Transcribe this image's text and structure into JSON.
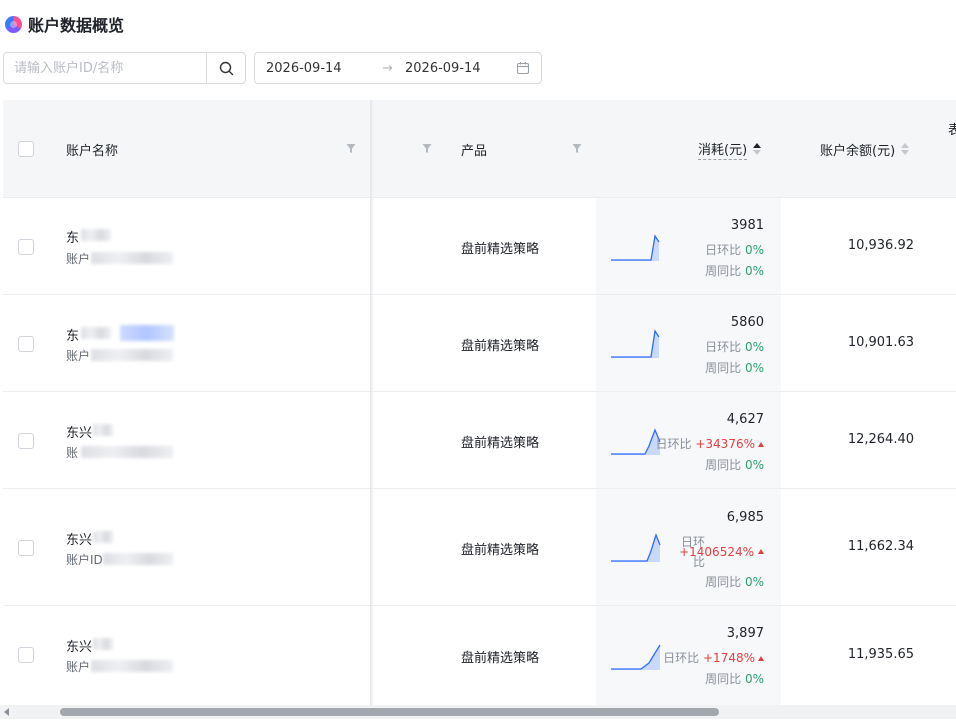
{
  "header": {
    "title": "账户数据概览"
  },
  "search": {
    "placeholder": "请输入账户ID/名称",
    "value": ""
  },
  "date_range": {
    "start": "2026-09-14",
    "separator": "→",
    "end": "2026-09-14"
  },
  "table": {
    "columns": {
      "name": "账户名称",
      "product": "产品",
      "cost": "消耗(元)",
      "balance": "账户余额(元)",
      "truncated": "表"
    },
    "rows": [
      {
        "name_prefix": "东",
        "sub_prefix": "账户",
        "product": "盘前精选策略",
        "cost": "3981",
        "day_label": "日环比",
        "day_pct": "0%",
        "day_trend": "flat",
        "week_label": "周同比",
        "week_pct": "0%",
        "balance": "10,936.92"
      },
      {
        "name_prefix": "东",
        "sub_prefix": "账户",
        "product": "盘前精选策略",
        "cost": "5860",
        "day_label": "日环比",
        "day_pct": "0%",
        "day_trend": "flat",
        "week_label": "周同比",
        "week_pct": "0%",
        "balance": "10,901.63"
      },
      {
        "name_prefix": "东兴",
        "sub_prefix": "账",
        "product": "盘前精选策略",
        "cost": "4,627",
        "day_label": "日环比",
        "day_pct": "+34376%",
        "day_trend": "up",
        "week_label": "周同比",
        "week_pct": "0%",
        "balance": "12,264.40"
      },
      {
        "name_prefix": "东兴",
        "sub_prefix": "账户ID",
        "product": "盘前精选策略",
        "cost": "6,985",
        "day_label": "日环比",
        "day_pct": "+1406524%",
        "day_trend": "up",
        "week_label": "周同比",
        "week_pct": "0%",
        "balance": "11,662.34"
      },
      {
        "name_prefix": "东兴",
        "sub_prefix": "账户",
        "product": "盘前精选策略",
        "cost": "3,897",
        "day_label": "日环比",
        "day_pct": "+1748%",
        "day_trend": "up",
        "week_label": "周同比",
        "week_pct": "0%",
        "balance": "11,935.65"
      }
    ]
  },
  "colors": {
    "up": "#e23f3f",
    "ok": "#2ba471",
    "spark": "#2f6bff"
  }
}
